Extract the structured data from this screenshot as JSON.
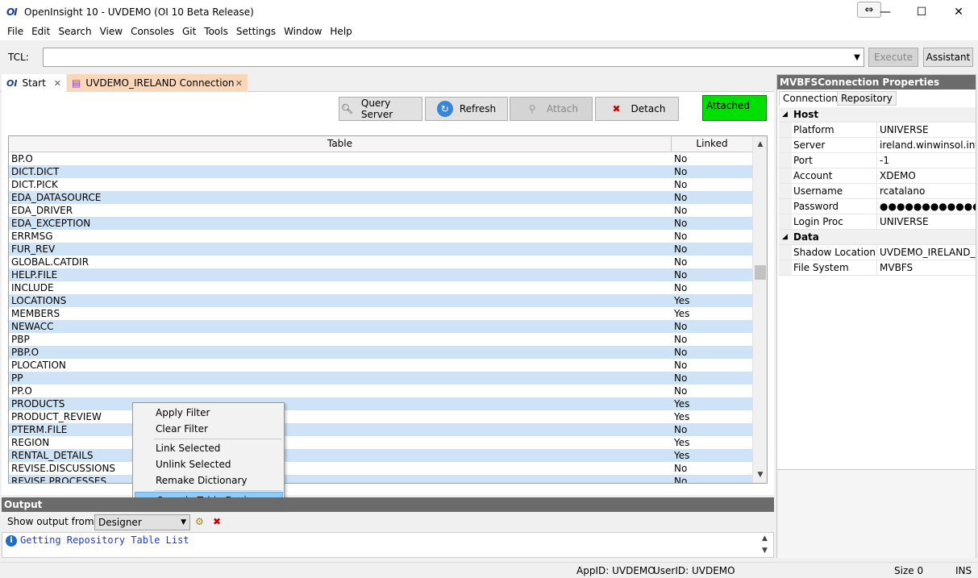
{
  "window": {
    "title": "OpenInsight 10 - UVDEMO (OI 10 Beta Release)",
    "logo": "OI",
    "restore_glyph": "⇔",
    "minimize": "—",
    "maximize": "☐",
    "close": "✕"
  },
  "menu": [
    "File",
    "Edit",
    "Search",
    "View",
    "Consoles",
    "Git",
    "Tools",
    "Settings",
    "Window",
    "Help"
  ],
  "tcl": {
    "label": "TCL:",
    "value": "",
    "execute_label": "Execute",
    "assistant_label": "Assistant"
  },
  "tabs": [
    {
      "label": "Start"
    },
    {
      "label": "UVDEMO_IRELAND Connection"
    }
  ],
  "toolbar": {
    "query_server": "Query Server",
    "refresh": "Refresh",
    "attach": "Attach",
    "detach": "Detach",
    "status": "Attached"
  },
  "table": {
    "col_table": "Table",
    "col_linked": "Linked",
    "rows": [
      {
        "name": "BP.O",
        "linked": "No"
      },
      {
        "name": "DICT.DICT",
        "linked": "No"
      },
      {
        "name": "DICT.PICK",
        "linked": "No"
      },
      {
        "name": "EDA_DATASOURCE",
        "linked": "No"
      },
      {
        "name": "EDA_DRIVER",
        "linked": "No"
      },
      {
        "name": "EDA_EXCEPTION",
        "linked": "No"
      },
      {
        "name": "ERRMSG",
        "linked": "No"
      },
      {
        "name": "FUR_REV",
        "linked": "No"
      },
      {
        "name": "GLOBAL.CATDIR",
        "linked": "No"
      },
      {
        "name": "HELP.FILE",
        "linked": "No"
      },
      {
        "name": "INCLUDE",
        "linked": "No"
      },
      {
        "name": "LOCATIONS",
        "linked": "Yes"
      },
      {
        "name": "MEMBERS",
        "linked": "Yes"
      },
      {
        "name": "NEWACC",
        "linked": "No"
      },
      {
        "name": "PBP",
        "linked": "No"
      },
      {
        "name": "PBP.O",
        "linked": "No"
      },
      {
        "name": "PLOCATION",
        "linked": "No"
      },
      {
        "name": "PP",
        "linked": "No"
      },
      {
        "name": "PP.O",
        "linked": "No"
      },
      {
        "name": "PRODUCTS",
        "linked": "Yes"
      },
      {
        "name": "PRODUCT_REVIEW",
        "linked": "Yes"
      },
      {
        "name": "PTERM.FILE",
        "linked": "No"
      },
      {
        "name": "REGION",
        "linked": "Yes"
      },
      {
        "name": "RENTAL_DETAILS",
        "linked": "Yes"
      },
      {
        "name": "REVISE.DISCUSSIONS",
        "linked": "No"
      },
      {
        "name": "REVISE.PROCESSES",
        "linked": "No"
      }
    ]
  },
  "context_menu": {
    "apply_filter": "Apply Filter",
    "clear_filter": "Clear Filter",
    "link_selected": "Link Selected",
    "unlink_selected": "Unlink Selected",
    "remake_dictionary": "Remake Dictionary",
    "open_table_designer": "Open in Table Designer"
  },
  "output": {
    "header": "Output",
    "show_from_label": "Show output from:",
    "source": "Designer",
    "log": "Getting Repository Table List"
  },
  "properties": {
    "header": "MVBFSConnection Properties",
    "tab_connection": "Connection",
    "tab_repository": "Repository",
    "cat_host": "Host",
    "cat_data": "Data",
    "host": [
      {
        "name": "Platform",
        "value": "UNIVERSE"
      },
      {
        "name": "Server",
        "value": "ireland.winwinsol.int"
      },
      {
        "name": "Port",
        "value": "-1"
      },
      {
        "name": "Account",
        "value": "XDEMO"
      },
      {
        "name": "Username",
        "value": "rcatalano"
      },
      {
        "name": "Password",
        "value": "●●●●●●●●●●●●"
      },
      {
        "name": "Login Proc",
        "value": "UNIVERSE"
      }
    ],
    "data": [
      {
        "name": "Shadow Location",
        "value": "UVDEMO_IRELAND_SH"
      },
      {
        "name": "File System",
        "value": "MVBFS"
      }
    ]
  },
  "status": {
    "app_id": "AppID: UVDEMO",
    "user_id": "UserID: UVDEMO",
    "size": "Size 0",
    "ins": "INS"
  }
}
